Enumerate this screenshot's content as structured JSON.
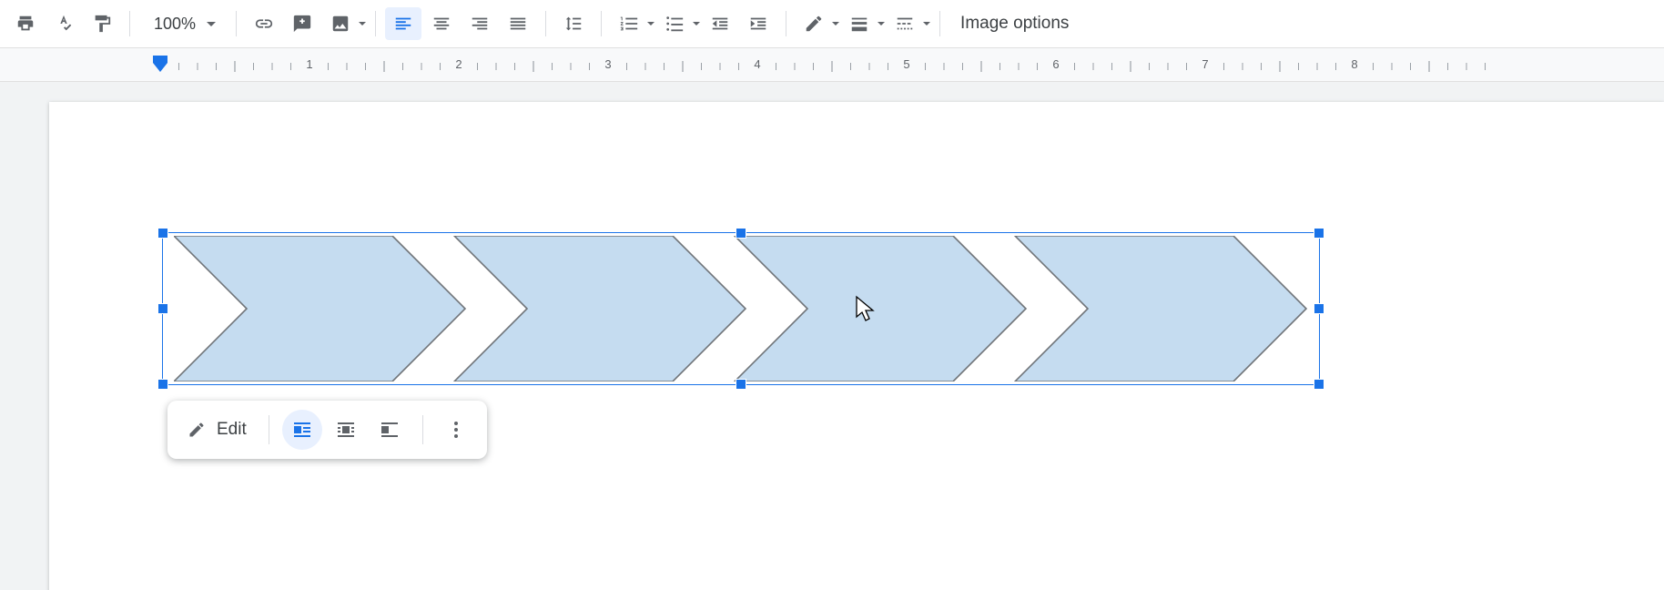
{
  "toolbar": {
    "zoom_value": "100%",
    "image_options_label": "Image options"
  },
  "ruler": {
    "labels": [
      "1",
      "2",
      "3",
      "4",
      "5",
      "6",
      "7",
      "8"
    ]
  },
  "palette": {
    "edit_label": "Edit"
  },
  "drawing": {
    "shape_fill": "#c5dcf0",
    "shape_stroke": "#707479",
    "selection_color": "#1a73e8"
  }
}
